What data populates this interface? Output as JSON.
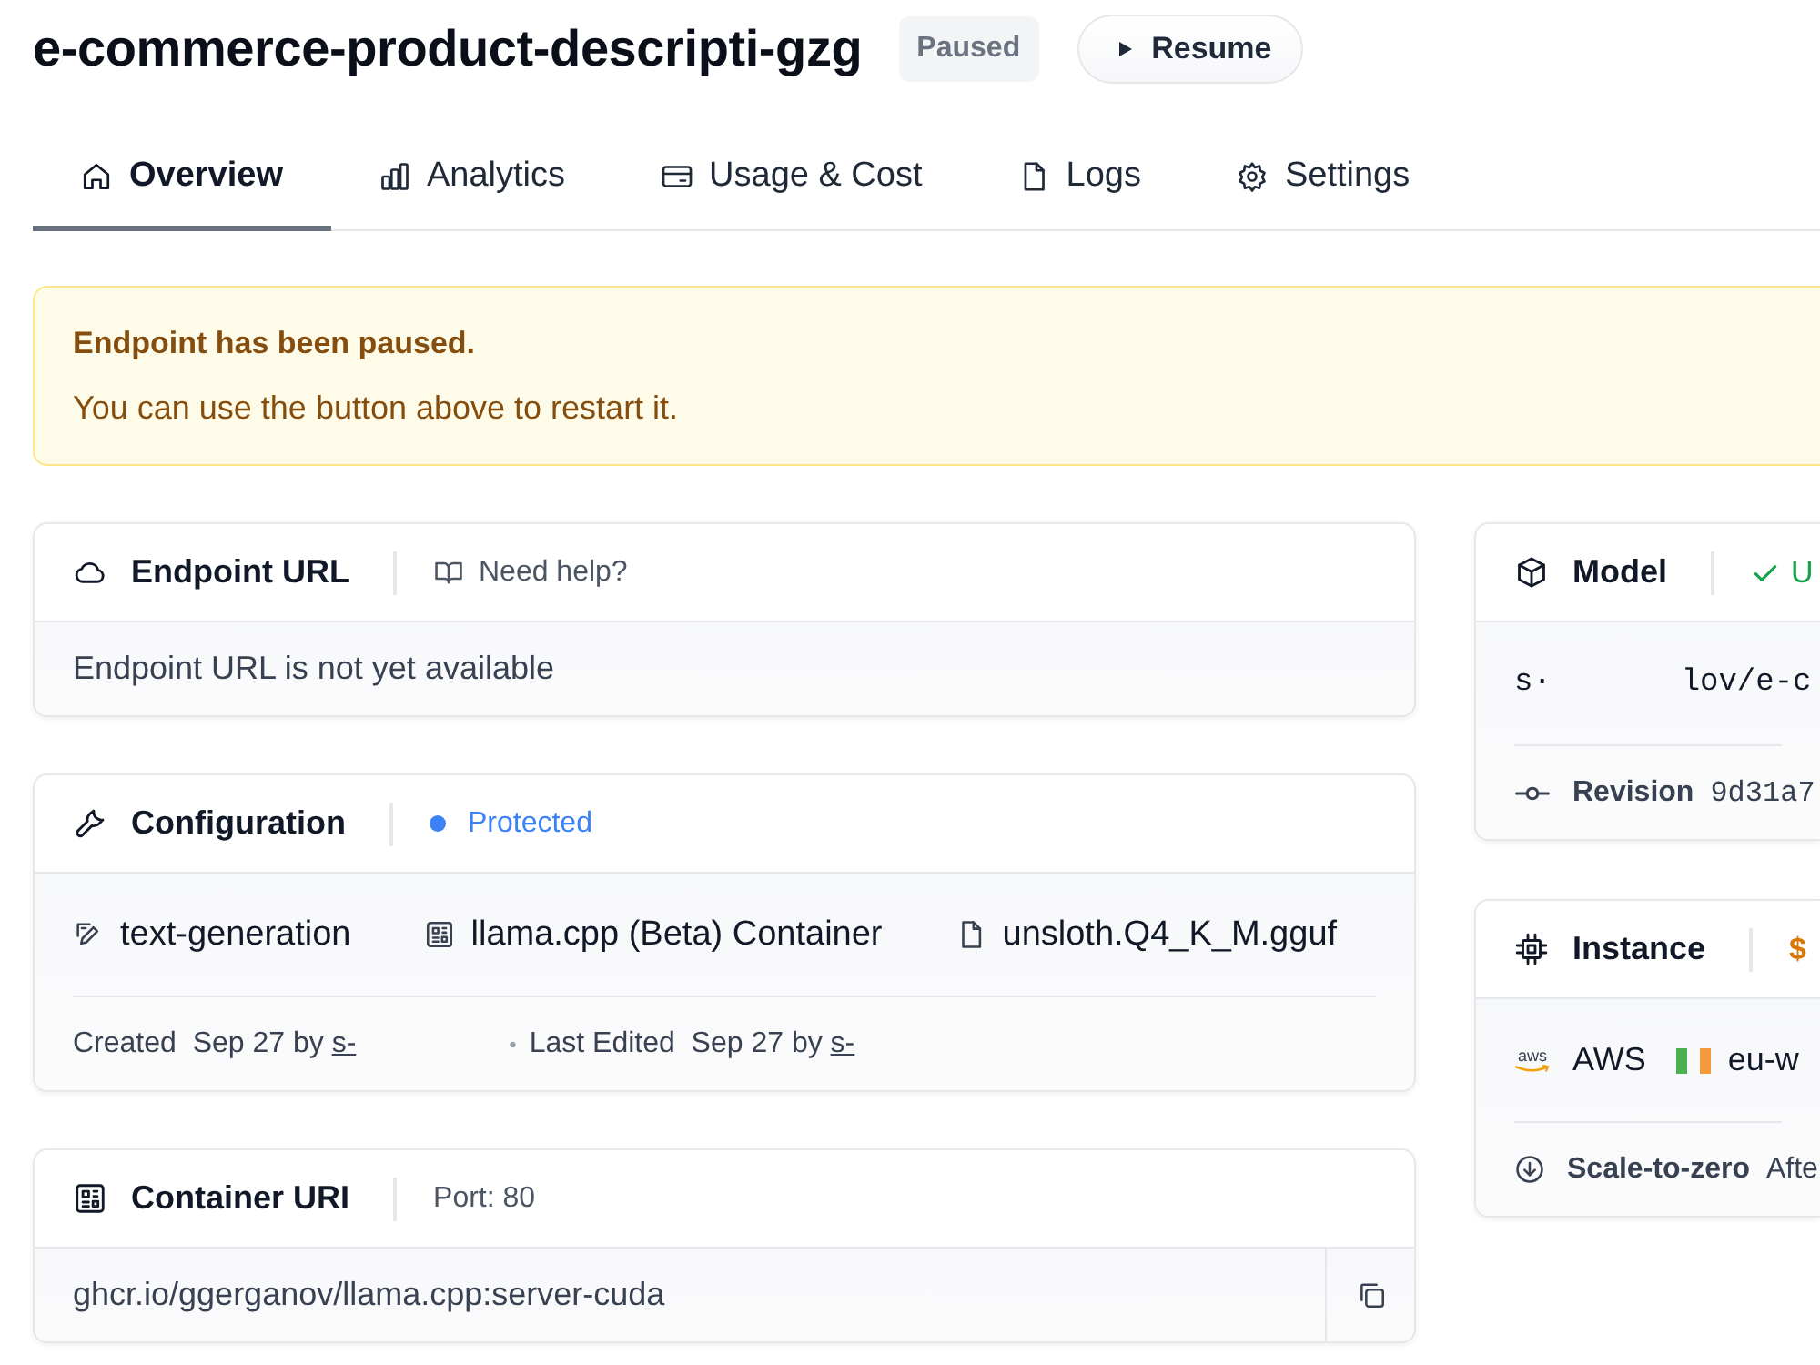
{
  "header": {
    "title": "e-commerce-product-descripti-gzg",
    "status": "Paused",
    "action": "Resume"
  },
  "tabs": [
    {
      "label": "Overview",
      "selected": true
    },
    {
      "label": "Analytics",
      "selected": false
    },
    {
      "label": "Usage & Cost",
      "selected": false
    },
    {
      "label": "Logs",
      "selected": false
    },
    {
      "label": "Settings",
      "selected": false
    }
  ],
  "alert": {
    "title": "Endpoint has been paused.",
    "message": "You can use the button above to restart it."
  },
  "endpoint_url": {
    "title": "Endpoint URL",
    "help_link": "Need help?",
    "message": "Endpoint URL is not yet available"
  },
  "configuration": {
    "title": "Configuration",
    "security": "Protected",
    "items": [
      "text-generation",
      "llama.cpp (Beta) Container",
      "unsloth.Q4_K_M.gguf"
    ],
    "created": {
      "label": "Created",
      "date": "Sep 27 by",
      "user": "s-"
    },
    "separator": "•",
    "edited": {
      "label": "Last Edited",
      "date": "Sep 27 by",
      "user": "s-"
    }
  },
  "container_uri": {
    "title": "Container URI",
    "port": "Port: 80",
    "uri": "ghcr.io/ggerganov/llama.cpp:server-cuda"
  },
  "model": {
    "title": "Model",
    "status": "U",
    "repository": "s·       lov/e-c",
    "revision_label": "Revision",
    "revision": "9d31a7"
  },
  "instance": {
    "title": "Instance",
    "price": "$",
    "provider_logo": "aws",
    "provider": "AWS",
    "region": "eu-w",
    "scale_label": "Scale-to-zero",
    "scale_value": "Afte"
  }
}
